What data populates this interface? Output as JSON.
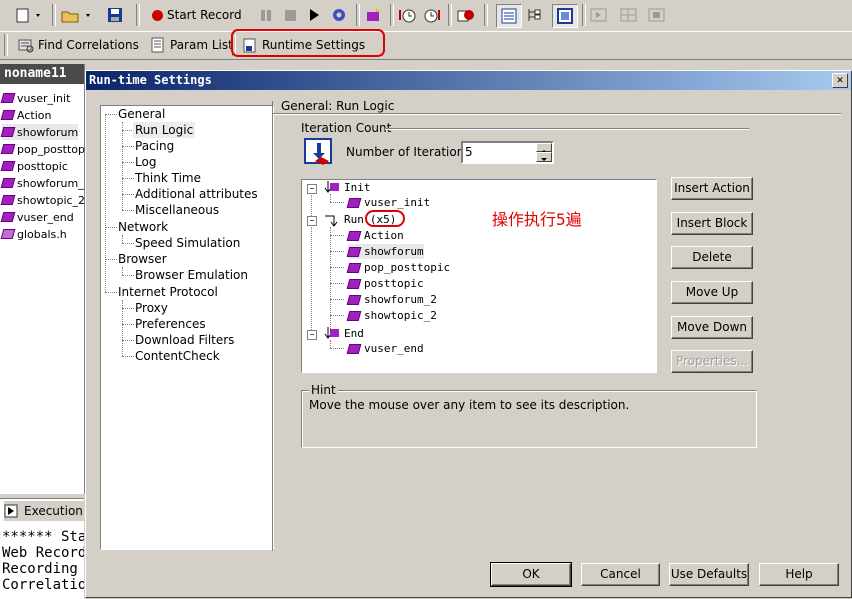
{
  "toolbar1": {
    "start_record_label": "Start Record"
  },
  "toolbar2": {
    "find_correlations_label": "Find Correlations",
    "param_list_label": "Param List",
    "runtime_settings_label": "Runtime Settings"
  },
  "left_panel": {
    "title": "noname11",
    "items": [
      {
        "label": "vuser_init"
      },
      {
        "label": "Action"
      },
      {
        "label": "showforum"
      },
      {
        "label": "pop_posttop"
      },
      {
        "label": "posttopic"
      },
      {
        "label": "showforum_"
      },
      {
        "label": "showtopic_2"
      },
      {
        "label": "vuser_end"
      },
      {
        "label": "globals.h"
      }
    ]
  },
  "bottom_panel": {
    "tab_label": "Execution",
    "lines": [
      "****** Sta",
      "Web Record",
      "Recording",
      "Correlatio"
    ]
  },
  "dialog": {
    "title": "Run-time Settings",
    "nav": [
      {
        "label": "General"
      },
      {
        "label": "Run Logic"
      },
      {
        "label": "Pacing"
      },
      {
        "label": "Log"
      },
      {
        "label": "Think Time"
      },
      {
        "label": "Additional attributes"
      },
      {
        "label": "Miscellaneous"
      },
      {
        "label": "Network"
      },
      {
        "label": "Speed Simulation"
      },
      {
        "label": "Browser"
      },
      {
        "label": "Browser Emulation"
      },
      {
        "label": "Internet Protocol"
      },
      {
        "label": "Proxy"
      },
      {
        "label": "Preferences"
      },
      {
        "label": "Download Filters"
      },
      {
        "label": "ContentCheck"
      }
    ],
    "section_title": "General: Run Logic",
    "iteration_group": "Iteration Count",
    "iterations_label": "Number of Iterations:",
    "iterations_value": "5",
    "tree": {
      "init": "Init",
      "vuser_init": "vuser_init",
      "run": "Run",
      "run_count": "(x5)",
      "action": "Action",
      "showforum": "showforum",
      "pop_posttopic": "pop_posttopic",
      "posttopic": "posttopic",
      "showforum_2": "showforum_2",
      "showtopic_2": "showtopic_2",
      "end": "End",
      "vuser_end": "vuser_end"
    },
    "annotation": "操作执行5遍",
    "buttons": {
      "insert_action": "Insert Action",
      "insert_block": "Insert Block",
      "delete": "Delete",
      "move_up": "Move Up",
      "move_down": "Move Down",
      "properties": "Properties..."
    },
    "hint_title": "Hint",
    "hint_text": "Move the mouse over any item to see its description.",
    "ok": "OK",
    "cancel": "Cancel",
    "use_defaults": "Use Defaults",
    "help": "Help"
  },
  "colors": {
    "window_bg": "#d4d0c8",
    "title_gradient_start": "#0a246a",
    "title_gradient_end": "#a6caf0",
    "highlight_red": "#e00000",
    "script_icon": "#a020c0"
  }
}
